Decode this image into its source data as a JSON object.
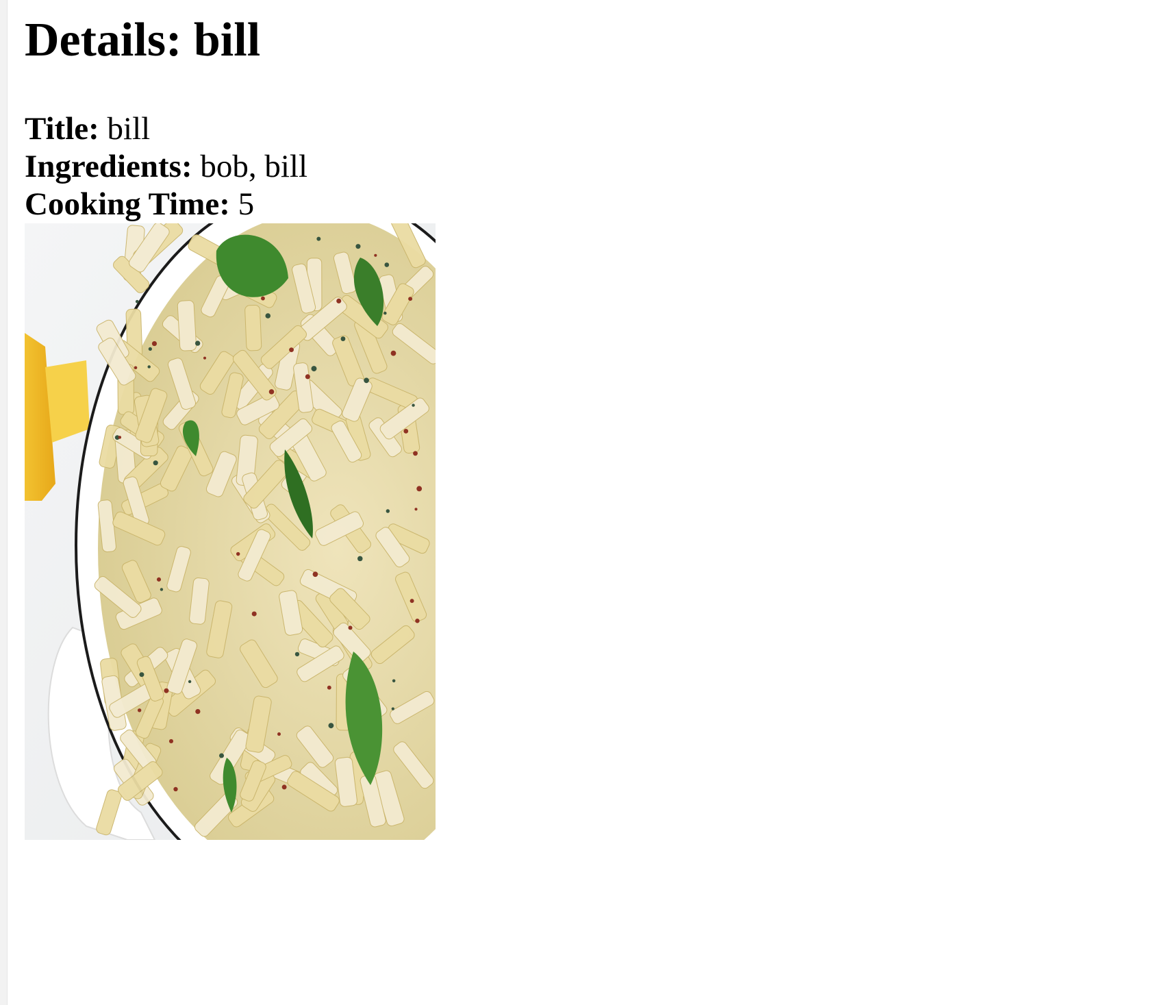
{
  "page": {
    "title": "Details: bill"
  },
  "details": {
    "title_label": "Title:",
    "title_value": "bill",
    "ingredients_label": "Ingredients:",
    "ingredients_value": "bob, bill",
    "cooking_time_label": "Cooking Time:",
    "cooking_time_value": "5"
  },
  "image": {
    "subject": "penne pasta dish with basil",
    "icon": "food-photo"
  },
  "colors": {
    "background": "#ffffff",
    "text": "#000000",
    "pasta": "#e8d9a0",
    "basil": "#3f8a2e",
    "plate": "#ffffff"
  }
}
